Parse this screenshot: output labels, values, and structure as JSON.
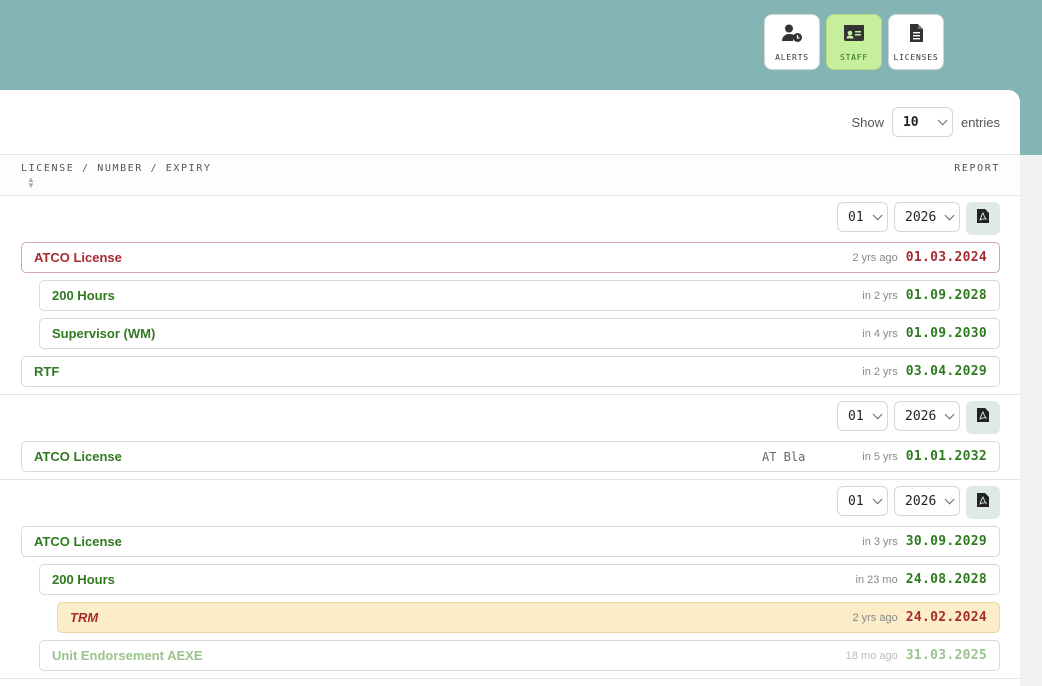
{
  "nav": {
    "alerts_label": "ALERTS",
    "staff_label": "STAFF",
    "licenses_label": "LICENSES"
  },
  "table_controls": {
    "show_label": "Show",
    "entries_value": "10",
    "entries_label": "entries"
  },
  "table_header": {
    "left": "LICENSE / NUMBER / EXPIRY",
    "right": "REPORT"
  },
  "groups": [
    {
      "month": "01",
      "year": "2026",
      "rows": [
        {
          "name": "ATCO License",
          "number": "",
          "relative": "2 yrs ago",
          "date": "01.03.2024",
          "status": "expired"
        },
        {
          "name": "200 Hours",
          "number": "",
          "relative": "in 2 yrs",
          "date": "01.09.2028",
          "status": "valid"
        },
        {
          "name": "Supervisor (WM)",
          "number": "",
          "relative": "in 4 yrs",
          "date": "01.09.2030",
          "status": "valid"
        },
        {
          "name": "RTF",
          "number": "",
          "relative": "in 2 yrs",
          "date": "03.04.2029",
          "status": "valid"
        }
      ]
    },
    {
      "month": "01",
      "year": "2026",
      "rows": [
        {
          "name": "ATCO License",
          "number": "AT Bla",
          "relative": "in 5 yrs",
          "date": "01.01.2032",
          "status": "valid"
        }
      ]
    },
    {
      "month": "01",
      "year": "2026",
      "rows": [
        {
          "name": "ATCO License",
          "number": "",
          "relative": "in 3 yrs",
          "date": "30.09.2029",
          "status": "valid"
        },
        {
          "name": "200 Hours",
          "number": "",
          "relative": "in 23 mo",
          "date": "24.08.2028",
          "status": "valid"
        },
        {
          "name": "TRM",
          "number": "",
          "relative": "2 yrs ago",
          "date": "24.02.2024",
          "status": "warning"
        },
        {
          "name": "Unit Endorsement AEXE",
          "number": "",
          "relative": "18 mo ago",
          "date": "31.03.2025",
          "status": "inactive"
        }
      ]
    }
  ]
}
